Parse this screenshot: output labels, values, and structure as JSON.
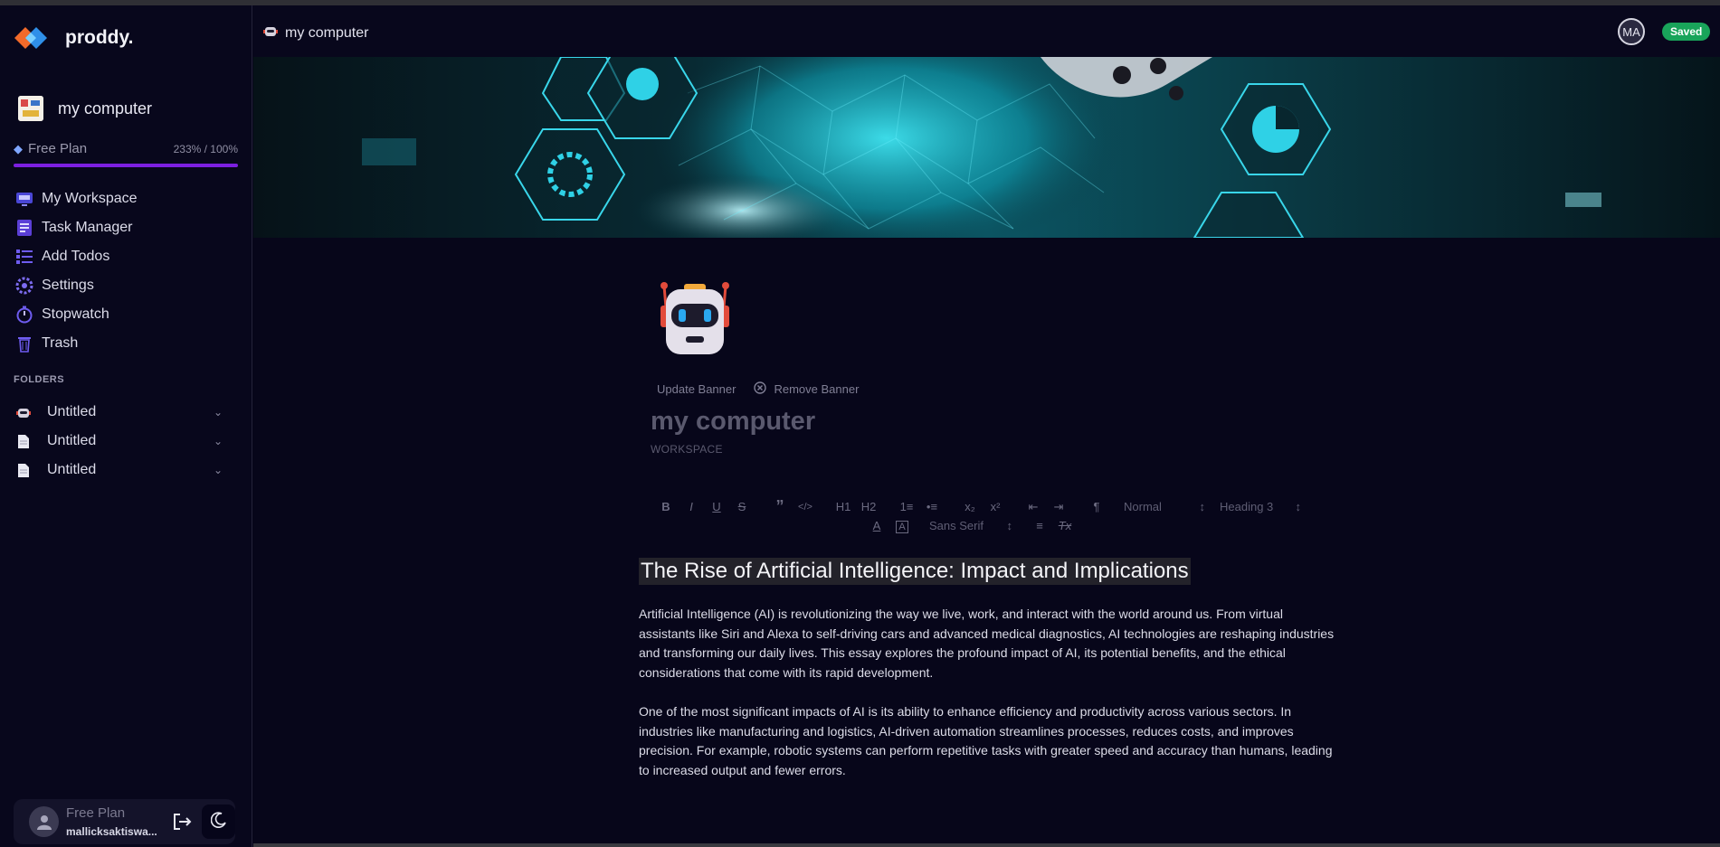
{
  "app": {
    "name": "proddy."
  },
  "sidebar": {
    "workspace_name": "my computer",
    "plan": {
      "label": "Free Plan",
      "usage": "233% / 100%",
      "usage_fraction": 1.0
    },
    "nav": [
      {
        "label": "My Workspace",
        "icon": "workspace-icon"
      },
      {
        "label": "Task Manager",
        "icon": "task-manager-icon"
      },
      {
        "label": "Add Todos",
        "icon": "todos-icon"
      },
      {
        "label": "Settings",
        "icon": "gear-icon"
      },
      {
        "label": "Stopwatch",
        "icon": "stopwatch-icon"
      },
      {
        "label": "Trash",
        "icon": "trash-icon"
      }
    ],
    "folders_label": "FOLDERS",
    "folders": [
      {
        "label": "Untitled",
        "icon": "robot-icon"
      },
      {
        "label": "Untitled",
        "icon": "document-icon"
      },
      {
        "label": "Untitled",
        "icon": "document-icon"
      }
    ],
    "user": {
      "plan": "Free Plan",
      "email": "mallicksaktiswa..."
    }
  },
  "topbar": {
    "breadcrumb": "my computer",
    "avatar_initials": "MA",
    "status": "Saved"
  },
  "page": {
    "update_banner": "Update Banner",
    "remove_banner": "Remove Banner",
    "title": "my computer",
    "subtitle": "WORKSPACE"
  },
  "toolbar": {
    "bold": "B",
    "italic": "I",
    "underline": "U",
    "strike": "S",
    "quote": "”",
    "code": "</>",
    "h1": "H1",
    "h2": "H2",
    "ordered_list": "1≡",
    "bullet_list": "•≡",
    "subscript": "x₂",
    "superscript": "x²",
    "outdent": "⇤",
    "indent": "⇥",
    "direction": "¶",
    "size_select": "Normal",
    "header_select": "Heading 3",
    "font_color": "A",
    "background": "A",
    "font_select": "Sans Serif",
    "align": "≡",
    "clean": "Tx"
  },
  "document": {
    "heading": "The Rise of Artificial Intelligence: Impact and Implications",
    "paragraphs": [
      "Artificial Intelligence (AI) is revolutionizing the way we live, work, and interact with the world around us. From virtual assistants like Siri and Alexa to self-driving cars and advanced medical diagnostics, AI technologies are reshaping industries and transforming our daily lives. This essay explores the profound impact of AI, its potential benefits, and the ethical considerations that come with its rapid development.",
      "One of the most significant impacts of AI is its ability to enhance efficiency and productivity across various sectors. In industries like manufacturing and logistics, AI-driven automation streamlines processes, reduces costs, and improves precision. For example, robotic systems can perform repetitive tasks with greater speed and accuracy than humans, leading to increased output and fewer errors."
    ]
  },
  "colors": {
    "accent": "#7c1fe0",
    "saved": "#19a45a",
    "background": "#07061a"
  }
}
